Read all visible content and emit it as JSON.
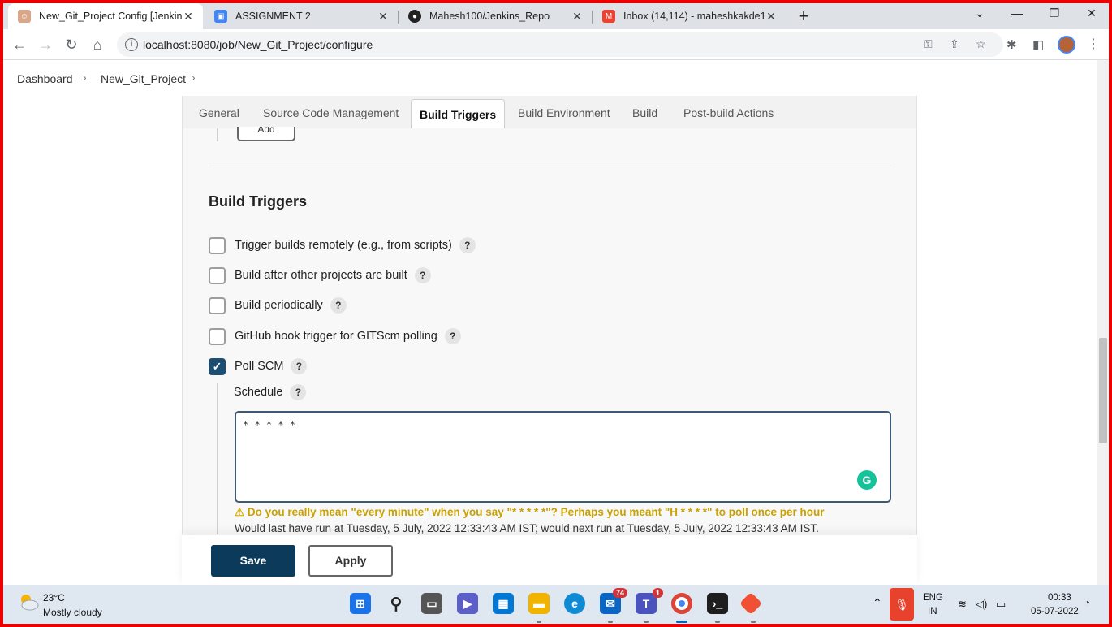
{
  "browser": {
    "tabs": [
      {
        "title": "New_Git_Project Config [Jenkins]",
        "active": true
      },
      {
        "title": "ASSIGNMENT 2",
        "active": false
      },
      {
        "title": "Mahesh100/Jenkins_Repo",
        "active": false
      },
      {
        "title": "Inbox (14,114) - maheshkakde10",
        "active": false
      }
    ],
    "url": "localhost:8080/job/New_Git_Project/configure",
    "new_tab": "+"
  },
  "breadcrumbs": [
    "Dashboard",
    "New_Git_Project"
  ],
  "config_tabs": [
    "General",
    "Source Code Management",
    "Build Triggers",
    "Build Environment",
    "Build",
    "Post-build Actions"
  ],
  "add_button": "Add",
  "section_title": "Build Triggers",
  "triggers": [
    {
      "label": "Trigger builds remotely (e.g., from scripts)",
      "checked": false
    },
    {
      "label": "Build after other projects are built",
      "checked": false
    },
    {
      "label": "Build periodically",
      "checked": false
    },
    {
      "label": "GitHub hook trigger for GITScm polling",
      "checked": false
    },
    {
      "label": "Poll SCM",
      "checked": true
    }
  ],
  "help": "?",
  "schedule": {
    "label": "Schedule",
    "value": "* * * * *",
    "warning": "Do you really mean \"every minute\" when you say \"* * * * *\"? Perhaps you meant \"H * * * *\" to poll once per hour",
    "note": "Would last have run at Tuesday, 5 July, 2022 12:33:43 AM IST; would next run at Tuesday, 5 July, 2022 12:33:43 AM IST."
  },
  "buttons": {
    "save": "Save",
    "apply": "Apply"
  },
  "taskbar": {
    "weather_temp": "23°C",
    "weather_desc": "Mostly cloudy",
    "mail_badge": "74",
    "teams_badge": "1",
    "lang_line1": "ENG",
    "lang_line2": "IN",
    "time": "00:33",
    "date": "05-07-2022"
  },
  "colors": {
    "save_bg": "#0b3a5b",
    "checkbox_checked": "#1e4d72",
    "warning_text": "#c9a100",
    "frame_border": "#ee0000"
  }
}
